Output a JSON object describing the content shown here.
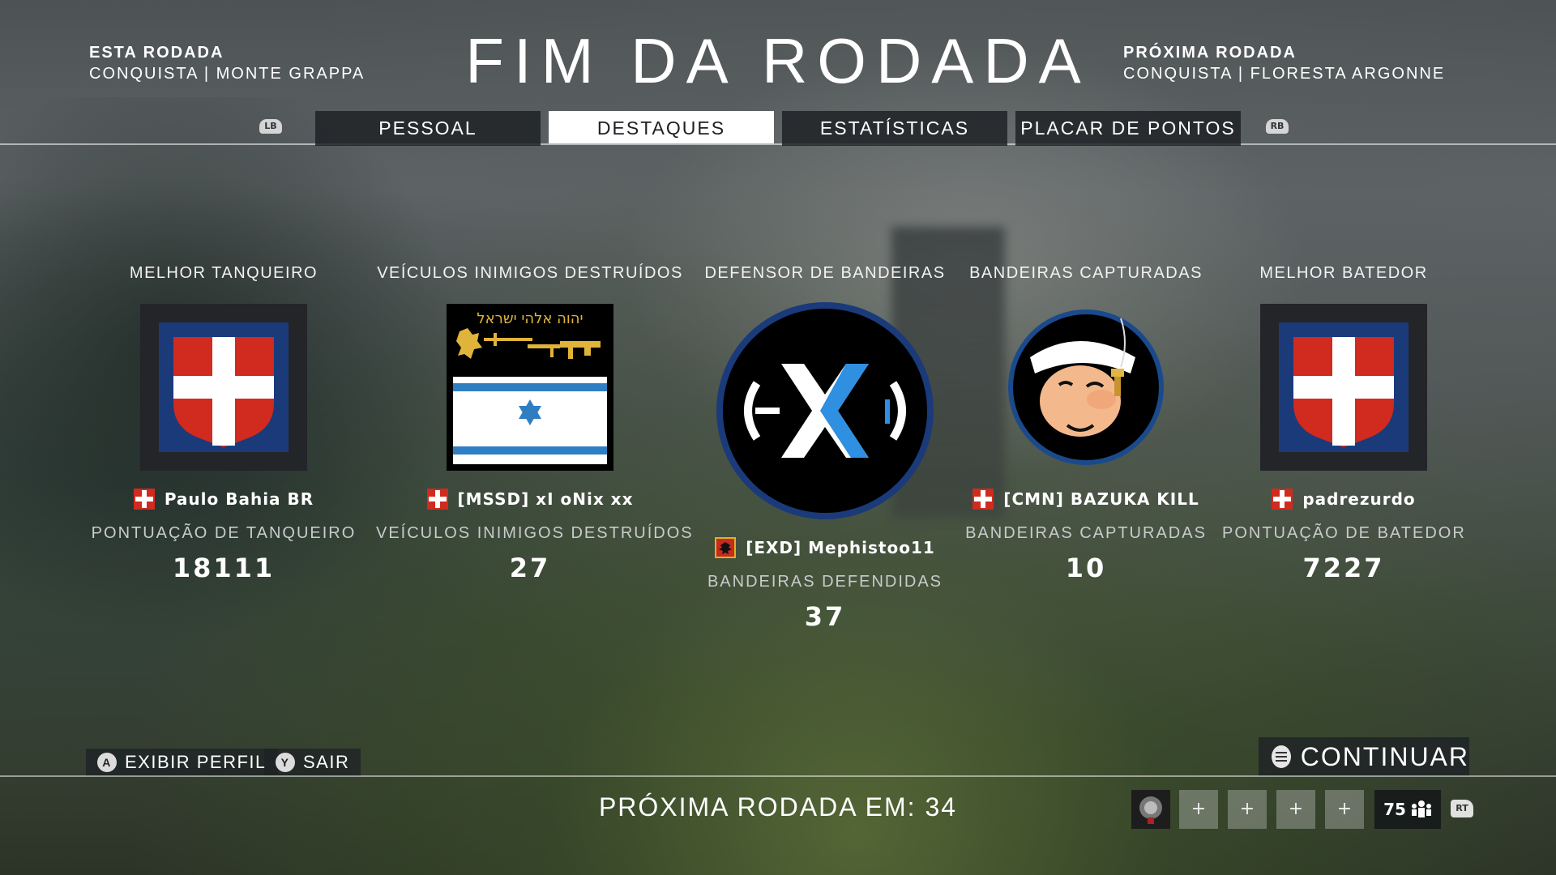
{
  "header": {
    "this_round_label": "ESTA RODADA",
    "this_round_value": "CONQUISTA | MONTE GRAPPA",
    "title": "FIM DA RODADA",
    "next_round_label": "PRÓXIMA RODADA",
    "next_round_value": "CONQUISTA | FLORESTA ARGONNE"
  },
  "tabs": {
    "left_bumper": "LB",
    "right_bumper": "RB",
    "items": [
      "PESSOAL",
      "DESTAQUES",
      "ESTATÍSTICAS",
      "PLACAR DE PONTOS"
    ],
    "active": "DESTAQUES"
  },
  "highlights": [
    {
      "category": "MELHOR TANQUEIRO",
      "player": "Paulo Bahia BR",
      "stat_label": "PONTUAÇÃO DE TANQUEIRO",
      "stat_value": "18111",
      "emblem": "savoy-cross-shield"
    },
    {
      "category": "VEÍCULOS INIMIGOS DESTRUÍDOS",
      "player": "[MSSD] xI oNix xx",
      "stat_label": "VEÍCULOS INIMIGOS DESTRUÍDOS",
      "stat_value": "27",
      "emblem": "star-of-david-flag"
    },
    {
      "category": "DEFENSOR DE BANDEIRAS",
      "player": "[EXD] Mephistoo11",
      "stat_label": "BANDEIRAS DEFENDIDAS",
      "stat_value": "37",
      "emblem": "exd-circle"
    },
    {
      "category": "BANDEIRAS CAPTURADAS",
      "player": "[CMN] BAZUKA KILL",
      "stat_label": "BANDEIRAS CAPTURADAS",
      "stat_value": "10",
      "emblem": "popeye-circle"
    },
    {
      "category": "MELHOR BATEDOR",
      "player": "padrezurdo",
      "stat_label": "PONTUAÇÃO DE BATEDOR",
      "stat_value": "7227",
      "emblem": "savoy-cross-shield"
    }
  ],
  "emblem_text": "יהוה אלהי ישראל",
  "footer": {
    "view_profile_key": "A",
    "view_profile": "EXIBIR PERFIL",
    "exit_key": "Y",
    "exit": "SAIR",
    "continue": "CONTINUAR",
    "next_round_countdown": "PRÓXIMA RODADA EM: 34",
    "squad_slot": "+",
    "rank": "75",
    "trigger": "RT"
  },
  "colors": {
    "savoy_red": "#d12a1f",
    "savoy_blue": "#1b3a7a",
    "exd_blue": "#2f8fe0",
    "tab_active_bg": "#ffffff",
    "tab_bg": "#1e2226"
  }
}
